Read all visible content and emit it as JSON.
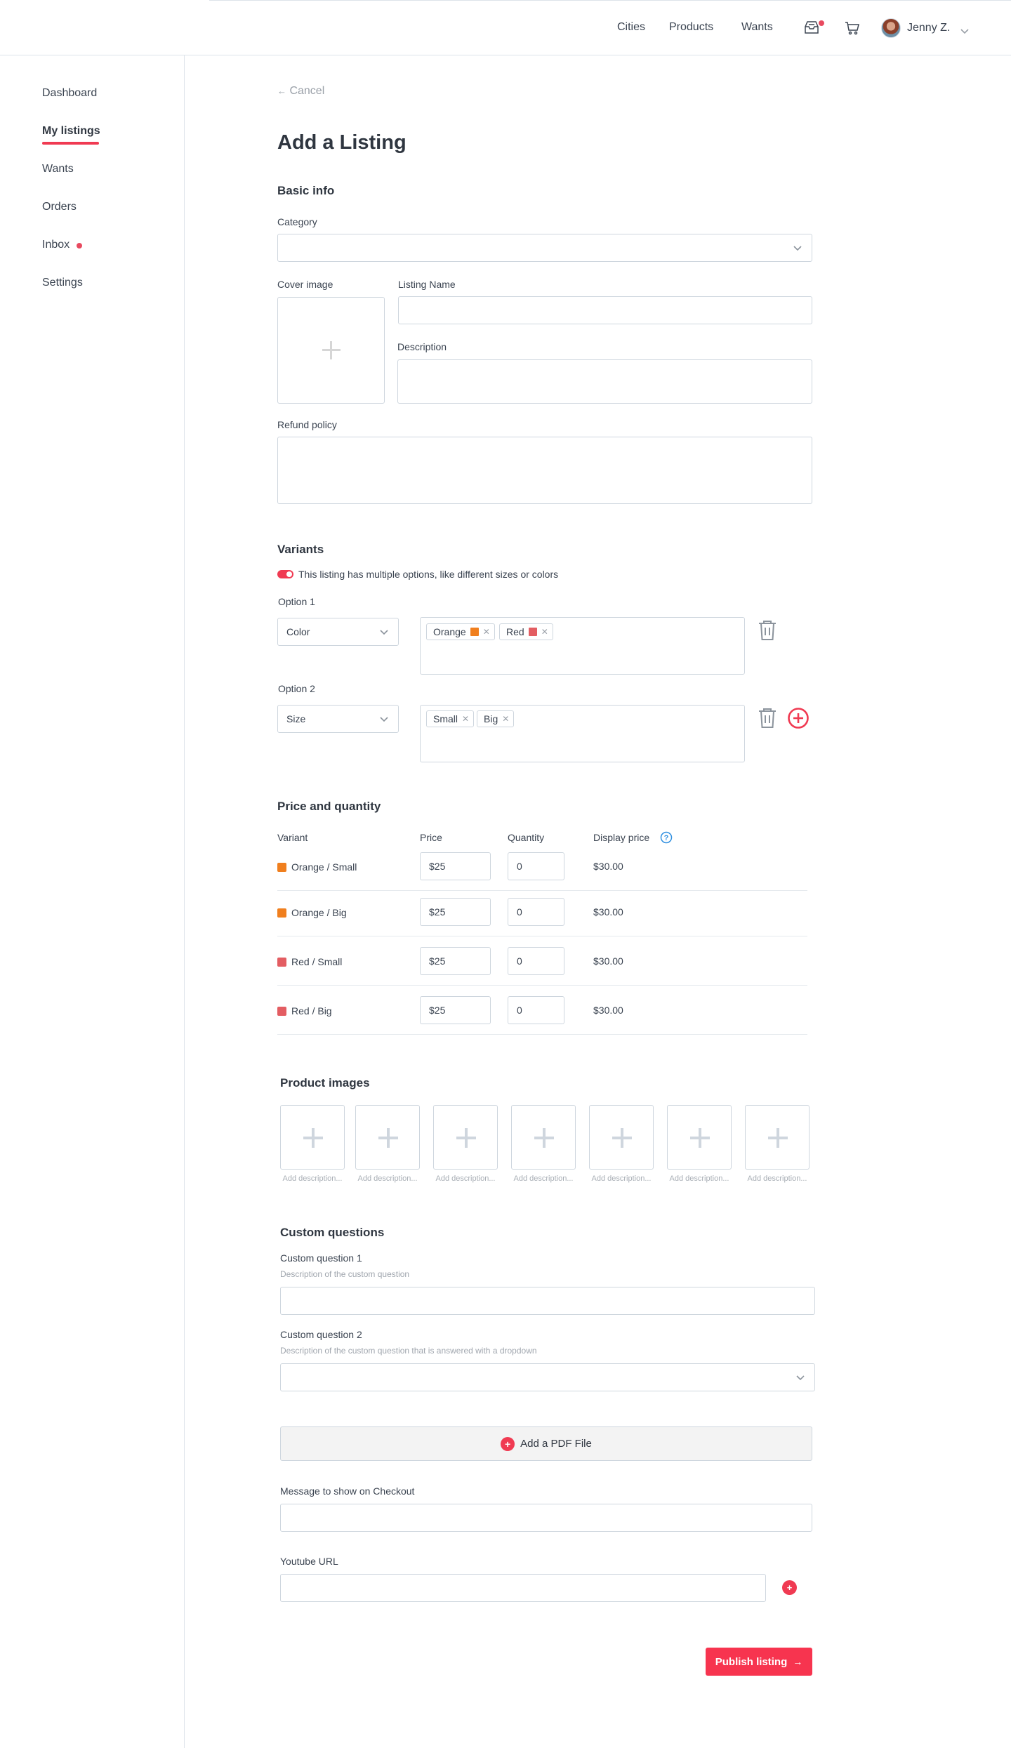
{
  "header": {
    "nav": [
      "Cities",
      "Products",
      "Wants"
    ],
    "icons": [
      "inbox-tray-icon",
      "cart-icon"
    ],
    "user_name": "Jenny Z.",
    "accent": "#f03a52"
  },
  "sidebar": {
    "items": [
      {
        "label": "Dashboard",
        "active": false
      },
      {
        "label": "My listings",
        "active": true
      },
      {
        "label": "Wants",
        "active": false
      },
      {
        "label": "Orders",
        "active": false
      },
      {
        "label": "Inbox",
        "active": false,
        "badge": true
      },
      {
        "label": "Settings",
        "active": false
      }
    ]
  },
  "page": {
    "cancel_label": "Cancel",
    "title": "Add a Listing"
  },
  "basic_info": {
    "section_title": "Basic info",
    "category_label": "Category",
    "category_value": "",
    "cover_image_label": "Cover image",
    "listing_name_label": "Listing Name",
    "listing_name_value": "",
    "description_label": "Description",
    "description_value": "",
    "refund_policy_label": "Refund policy",
    "refund_policy_value": ""
  },
  "variants": {
    "section_title": "Variants",
    "toggle_label": "This listing has multiple options, like different sizes or colors",
    "toggle_on": true,
    "options": [
      {
        "label": "Option 1",
        "type": "Color",
        "values": [
          {
            "name": "Orange",
            "color": "#f07f1e"
          },
          {
            "name": "Red",
            "color": "#e35d62"
          }
        ]
      },
      {
        "label": "Option 2",
        "type": "Size",
        "values": [
          {
            "name": "Small"
          },
          {
            "name": "Big"
          }
        ]
      }
    ]
  },
  "price_quantity": {
    "section_title": "Price and quantity",
    "columns": [
      "Variant",
      "Price",
      "Quantity",
      "Display price"
    ],
    "rows": [
      {
        "variant": "Orange / Small",
        "color": "#f07f1e",
        "price": "$25",
        "quantity": "0",
        "display_price": "$30.00"
      },
      {
        "variant": "Orange / Big",
        "color": "#f07f1e",
        "price": "$25",
        "quantity": "0",
        "display_price": "$30.00"
      },
      {
        "variant": "Red / Small",
        "color": "#e35d62",
        "price": "$25",
        "quantity": "0",
        "display_price": "$30.00"
      },
      {
        "variant": "Red / Big",
        "color": "#e35d62",
        "price": "$25",
        "quantity": "0",
        "display_price": "$30.00"
      }
    ]
  },
  "product_images": {
    "section_title": "Product images",
    "slots": [
      {
        "desc": "Add description..."
      },
      {
        "desc": "Add description..."
      },
      {
        "desc": "Add description..."
      },
      {
        "desc": "Add description..."
      },
      {
        "desc": "Add description..."
      },
      {
        "desc": "Add description..."
      },
      {
        "desc": "Add description..."
      }
    ]
  },
  "custom_questions": {
    "section_title": "Custom questions",
    "q1_label": "Custom question 1",
    "q1_hint": "Description of the custom question",
    "q1_value": "",
    "q2_label": "Custom question 2",
    "q2_hint": "Description of the custom question that is answered with a dropdown",
    "q2_value": ""
  },
  "extras": {
    "pdf_button_label": "Add a PDF File",
    "checkout_message_label": "Message to show on Checkout",
    "checkout_message_value": "",
    "youtube_label": "Youtube URL",
    "youtube_value": ""
  },
  "footer": {
    "publish_label": "Publish listing"
  }
}
